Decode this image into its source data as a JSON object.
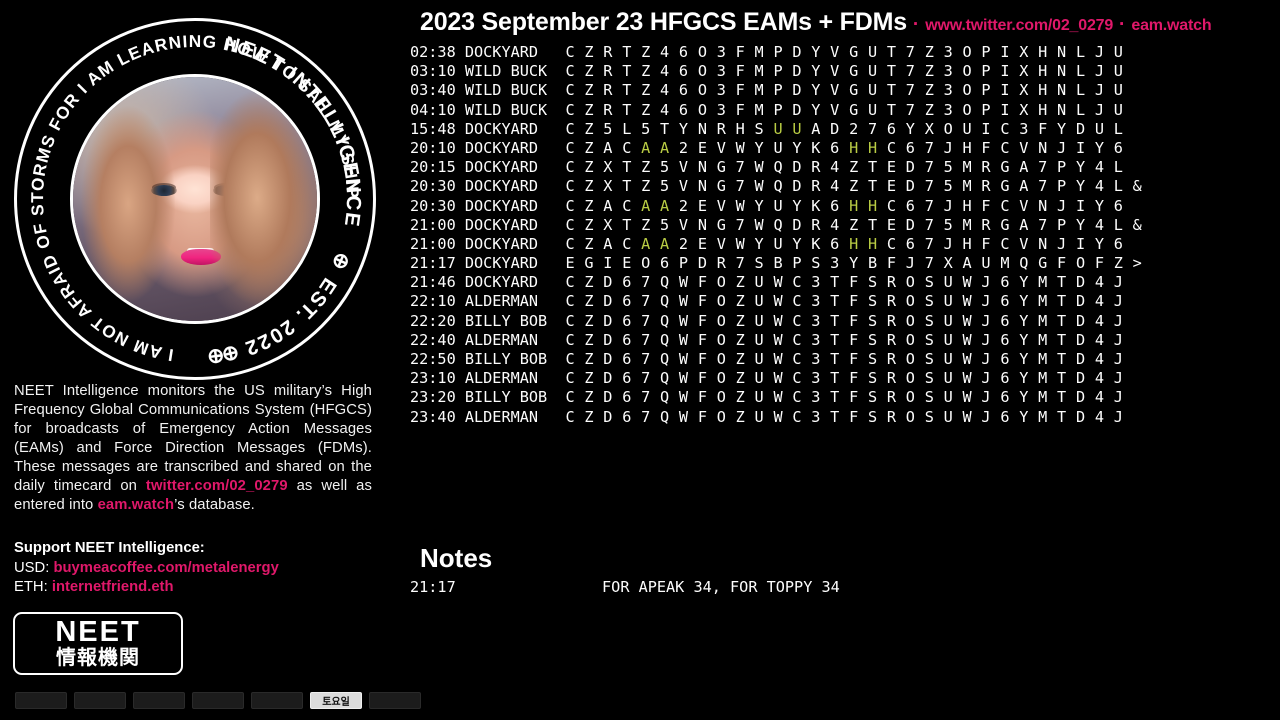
{
  "header": {
    "title": "2023 September 23 HFGCS EAMs + FDMs",
    "separator": "·",
    "link_twitter": "www.twitter.com/02_0279",
    "link_eam": "eam.watch",
    "accent_color": "#e0186a"
  },
  "badge": {
    "top_text": "NEET INTELLIGENCE",
    "right_text": "EST. 2022",
    "bottom_text": "I AM NOT AFRAID OF STORMS FOR I AM LEARNING HOW TO SAIL MY SHIP",
    "dot_glyph": "⊕"
  },
  "description": {
    "part1": "NEET Intelligence monitors the US military’s High Frequency Global Communications System (HFGCS) for broadcasts of Emergency Action Messages (EAMs) and Force Direction Messages (FDMs). These messages are transcribed and shared on the daily timecard on ",
    "link1": "twitter.com/02_0279",
    "part2": " as well as entered into ",
    "link2": "eam.watch",
    "part3": "’s database."
  },
  "support": {
    "heading": "Support NEET Intelligence:",
    "usd_label": "USD:",
    "usd_link": "buymeacoffee.com/metalenergy",
    "eth_label": "ETH:",
    "eth_link": "internetfriend.eth"
  },
  "logo": {
    "latin": "NEET",
    "japanese": "情報機関"
  },
  "messages": {
    "highlight_color": "#b9cc44",
    "rows": [
      {
        "time": "02:38",
        "station": "DOCKYARD",
        "body": "C Z R T Z 4 6 O 3 F M P D Y V G U T 7 Z 3 O P I X H N L J U",
        "highlights": []
      },
      {
        "time": "03:10",
        "station": "WILD BUCK",
        "body": "C Z R T Z 4 6 O 3 F M P D Y V G U T 7 Z 3 O P I X H N L J U",
        "highlights": []
      },
      {
        "time": "03:40",
        "station": "WILD BUCK",
        "body": "C Z R T Z 4 6 O 3 F M P D Y V G U T 7 Z 3 O P I X H N L J U",
        "highlights": []
      },
      {
        "time": "04:10",
        "station": "WILD BUCK",
        "body": "C Z R T Z 4 6 O 3 F M P D Y V G U T 7 Z 3 O P I X H N L J U",
        "highlights": []
      },
      {
        "time": "15:48",
        "station": "DOCKYARD",
        "body": "C Z 5 L 5 T Y N R H S U U A D 2 7 6 Y X O U I C 3 F Y D U L",
        "highlights": [
          11,
          12
        ]
      },
      {
        "time": "20:10",
        "station": "DOCKYARD",
        "body": "C Z A C A A 2 E V W Y U Y K 6 H H C 6 7 J H F C V N J I Y 6",
        "highlights": [
          4,
          5,
          15,
          16
        ]
      },
      {
        "time": "20:15",
        "station": "DOCKYARD",
        "body": "C Z X T Z 5 V N G 7 W Q D R 4 Z T E D 7 5 M R G A 7 P Y 4 L",
        "highlights": []
      },
      {
        "time": "20:30",
        "station": "DOCKYARD",
        "body": "C Z X T Z 5 V N G 7 W Q D R 4 Z T E D 7 5 M R G A 7 P Y 4 L &",
        "highlights": []
      },
      {
        "time": "20:30",
        "station": "DOCKYARD",
        "body": "C Z A C A A 2 E V W Y U Y K 6 H H C 6 7 J H F C V N J I Y 6",
        "highlights": [
          4,
          5,
          15,
          16
        ]
      },
      {
        "time": "21:00",
        "station": "DOCKYARD",
        "body": "C Z X T Z 5 V N G 7 W Q D R 4 Z T E D 7 5 M R G A 7 P Y 4 L &",
        "highlights": []
      },
      {
        "time": "21:00",
        "station": "DOCKYARD",
        "body": "C Z A C A A 2 E V W Y U Y K 6 H H C 6 7 J H F C V N J I Y 6",
        "highlights": [
          4,
          5,
          15,
          16
        ]
      },
      {
        "time": "21:17",
        "station": "DOCKYARD",
        "body": "E G I E O 6 P D R 7 S B P S 3 Y B F J 7 X A U M Q G F O F Z >",
        "highlights": []
      },
      {
        "time": "21:46",
        "station": "DOCKYARD",
        "body": "C Z D 6 7 Q W F O Z U W C 3 T F S R O S U W J 6 Y M T D 4 J",
        "highlights": []
      },
      {
        "time": "22:10",
        "station": "ALDERMAN",
        "body": "C Z D 6 7 Q W F O Z U W C 3 T F S R O S U W J 6 Y M T D 4 J",
        "highlights": []
      },
      {
        "time": "22:20",
        "station": "BILLY BOB",
        "body": "C Z D 6 7 Q W F O Z U W C 3 T F S R O S U W J 6 Y M T D 4 J",
        "highlights": []
      },
      {
        "time": "22:40",
        "station": "ALDERMAN",
        "body": "C Z D 6 7 Q W F O Z U W C 3 T F S R O S U W J 6 Y M T D 4 J",
        "highlights": []
      },
      {
        "time": "22:50",
        "station": "BILLY BOB",
        "body": "C Z D 6 7 Q W F O Z U W C 3 T F S R O S U W J 6 Y M T D 4 J",
        "highlights": []
      },
      {
        "time": "23:10",
        "station": "ALDERMAN",
        "body": "C Z D 6 7 Q W F O Z U W C 3 T F S R O S U W J 6 Y M T D 4 J",
        "highlights": []
      },
      {
        "time": "23:20",
        "station": "BILLY BOB",
        "body": "C Z D 6 7 Q W F O Z U W C 3 T F S R O S U W J 6 Y M T D 4 J",
        "highlights": []
      },
      {
        "time": "23:40",
        "station": "ALDERMAN",
        "body": "C Z D 6 7 Q W F O Z U W C 3 T F S R O S U W J 6 Y M T D 4 J",
        "highlights": []
      }
    ]
  },
  "notes": {
    "title": "Notes",
    "entries": [
      {
        "time": "21:17",
        "text": "FOR APEAK 34, FOR TOPPY 34"
      }
    ]
  },
  "taskbar": {
    "buttons": [
      {
        "label": "",
        "active": false
      },
      {
        "label": "",
        "active": false
      },
      {
        "label": "",
        "active": false
      },
      {
        "label": "",
        "active": false
      },
      {
        "label": "",
        "active": false
      },
      {
        "label": "토요일",
        "active": true
      },
      {
        "label": "",
        "active": false
      }
    ]
  }
}
